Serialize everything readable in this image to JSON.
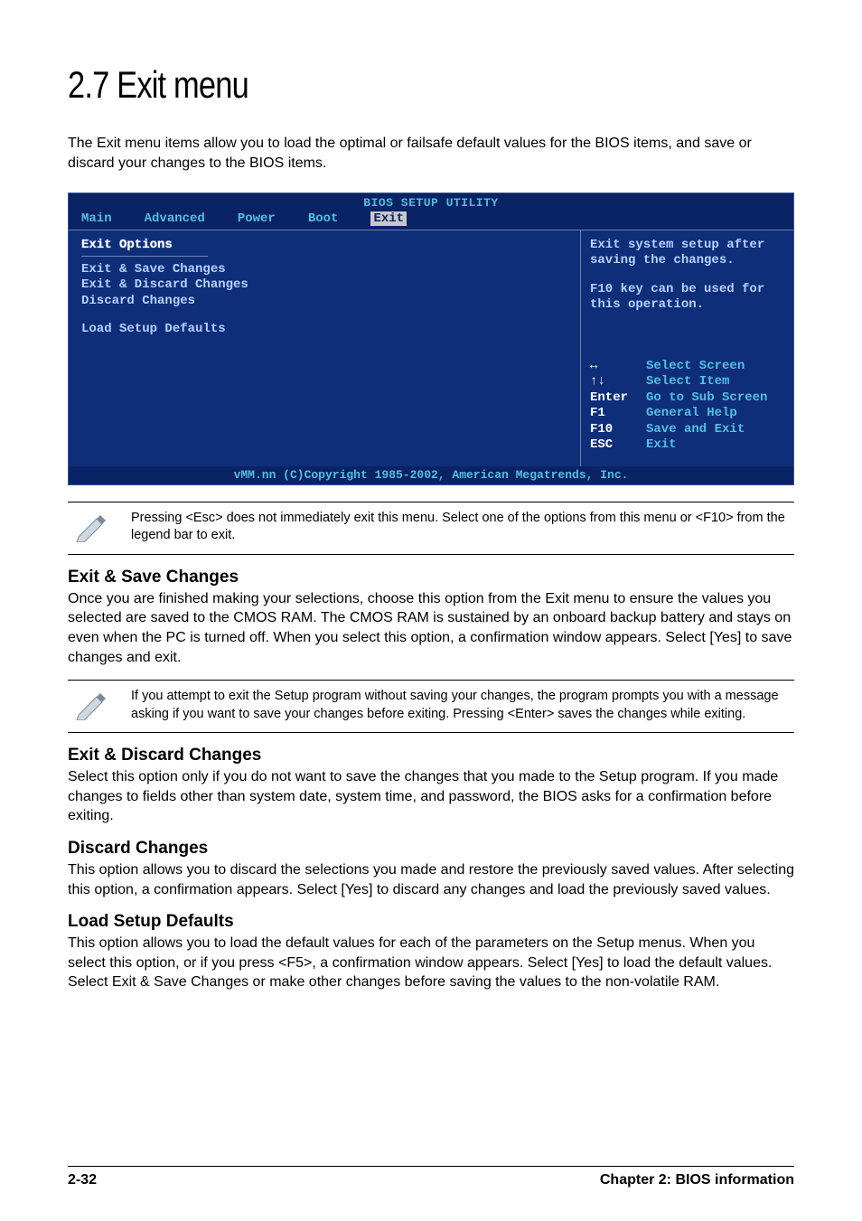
{
  "page": {
    "title": "2.7    Exit menu",
    "intro": "The Exit menu items allow you to load the optimal or failsafe default values for the BIOS items, and save or discard your changes to the BIOS items."
  },
  "bios": {
    "header": "BIOS SETUP UTILITY",
    "tabs": {
      "main": "Main",
      "advanced": "Advanced",
      "power": "Power",
      "boot": "Boot",
      "exit": "Exit"
    },
    "left": {
      "group": "Exit Options",
      "item1": "Exit & Save Changes",
      "item2": "Exit & Discard Changes",
      "item3": "Discard Changes",
      "item4": "Load Setup Defaults"
    },
    "right": {
      "help1": "Exit system setup after saving the changes.",
      "help2": "F10 key can be used for this operation."
    },
    "legend": {
      "k1": "↔",
      "v1": "Select Screen",
      "k2": "↑↓",
      "v2": "Select Item",
      "k3": "Enter",
      "v3": "Go to Sub Screen",
      "k4": "F1",
      "v4": "General Help",
      "k5": "F10",
      "v5": "Save and Exit",
      "k6": "ESC",
      "v6": "Exit"
    },
    "footer": "vMM.nn (C)Copyright 1985-2002, American Megatrends, Inc."
  },
  "note1": "Pressing <Esc> does not immediately exit this menu. Select one of the options from this menu or <F10> from the legend bar to exit.",
  "sections": {
    "save": {
      "heading": "Exit & Save Changes",
      "body": "Once you are finished making your selections, choose this option from the Exit menu to ensure the values you selected are saved to the CMOS RAM. The CMOS RAM is sustained by an onboard backup battery and stays on even when the PC is turned off. When you select this option, a confirmation window appears. Select [Yes] to save changes and exit."
    }
  },
  "note2": "If you attempt to exit the Setup program without saving your changes, the program prompts you with a message asking if you want to save your changes before exiting. Pressing <Enter> saves the  changes while exiting.",
  "sections2": {
    "discard_exit": {
      "heading": "Exit & Discard Changes",
      "body": "Select this option only if you do not want to save the changes that you made to the Setup program. If you made changes to fields other than system date, system time, and password, the BIOS asks for a confirmation before exiting."
    },
    "discard": {
      "heading": "Discard Changes",
      "body": "This option allows you to discard the selections you made and restore the previously saved values. After selecting this option, a confirmation appears. Select [Yes] to discard any changes and load the previously saved values."
    },
    "defaults": {
      "heading": "Load Setup Defaults",
      "body": "This option allows you to load the default values for each of the parameters on the Setup menus. When you select this option, or if you press <F5>, a confirmation window appears. Select [Yes] to load the default values. Select Exit & Save Changes or make other changes before saving the values to the non-volatile RAM."
    }
  },
  "footer": {
    "page_number": "2-32",
    "chapter": "Chapter 2: BIOS information"
  }
}
